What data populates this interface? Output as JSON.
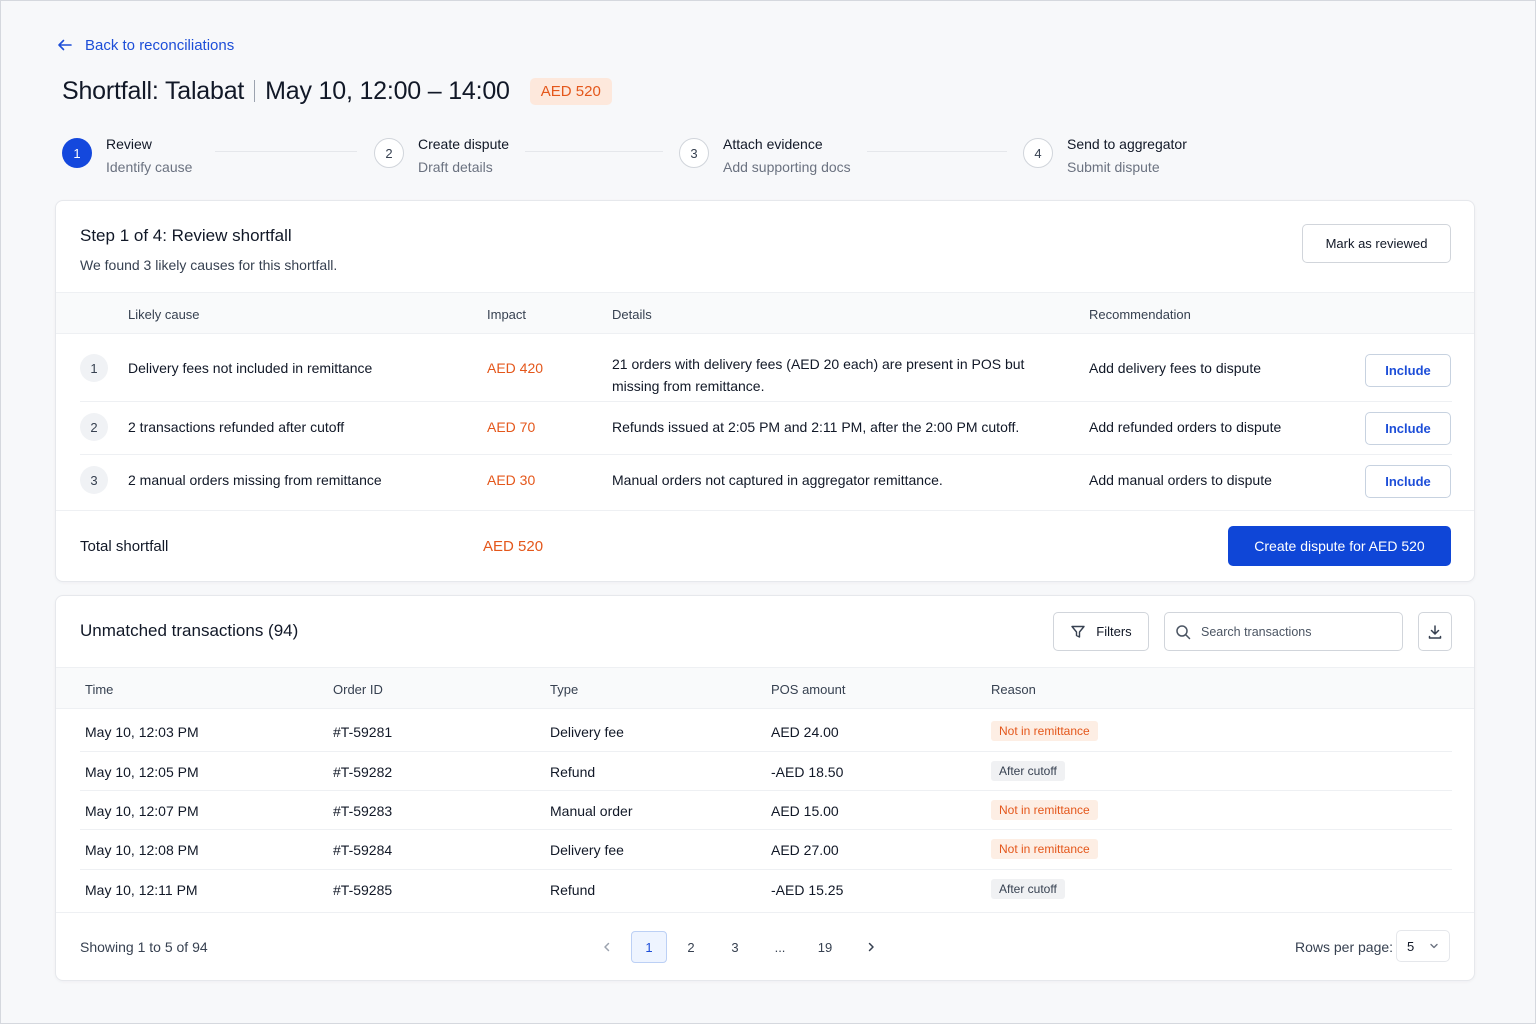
{
  "back_link": {
    "label": "Back to reconciliations"
  },
  "header": {
    "title_left": "Shortfall: Talabat",
    "title_right": "May 10, 12:00 – 14:00",
    "amount_badge": "AED 520"
  },
  "steps": [
    {
      "num": "1",
      "title": "Review",
      "subtitle": "Identify cause"
    },
    {
      "num": "2",
      "title": "Create dispute",
      "subtitle": "Draft details"
    },
    {
      "num": "3",
      "title": "Attach evidence",
      "subtitle": "Add supporting docs"
    },
    {
      "num": "4",
      "title": "Send to aggregator",
      "subtitle": "Submit dispute"
    }
  ],
  "review": {
    "title": "Step 1 of 4: Review shortfall",
    "subtitle": "We found 3 likely causes for this shortfall.",
    "mark_reviewed": "Mark as reviewed",
    "columns": {
      "cause": "Likely cause",
      "impact": "Impact",
      "details": "Details",
      "recommendation": "Recommendation"
    },
    "rows": [
      {
        "num": "1",
        "cause": "Delivery fees not included in remittance",
        "impact": "AED 420",
        "details_1": "21 orders with delivery fees (AED 20 each) are present in POS but",
        "details_2": "missing from remittance.",
        "recommendation": "Add delivery fees to dispute",
        "action": "Include"
      },
      {
        "num": "2",
        "cause": "2 transactions refunded after cutoff",
        "impact": "AED 70",
        "details_1": "Refunds issued at 2:05 PM and 2:11 PM, after the 2:00 PM cutoff.",
        "details_2": "",
        "recommendation": "Add refunded orders to dispute",
        "action": "Include"
      },
      {
        "num": "3",
        "cause": "2 manual orders missing from remittance",
        "impact": "AED 30",
        "details_1": "Manual orders not captured in aggregator remittance.",
        "details_2": "",
        "recommendation": "Add manual orders to dispute",
        "action": "Include"
      }
    ],
    "total_label": "Total shortfall",
    "total_value": "AED 520",
    "create_button": "Create dispute for AED 520"
  },
  "unmatched": {
    "title": "Unmatched transactions (94)",
    "filters_label": "Filters",
    "search_placeholder": "Search transactions",
    "columns": {
      "time": "Time",
      "order_id": "Order ID",
      "type": "Type",
      "pos_amount": "POS amount",
      "reason": "Reason"
    },
    "rows": [
      {
        "time": "May 10, 12:03 PM",
        "order_id": "#T-59281",
        "type": "Delivery fee",
        "amount": "AED 24.00",
        "reason": "Not in remittance",
        "reason_kind": "orange"
      },
      {
        "time": "May 10, 12:05 PM",
        "order_id": "#T-59282",
        "type": "Refund",
        "amount": "-AED 18.50",
        "reason": "After cutoff",
        "reason_kind": "gray"
      },
      {
        "time": "May 10, 12:07 PM",
        "order_id": "#T-59283",
        "type": "Manual order",
        "amount": "AED 15.00",
        "reason": "Not in remittance",
        "reason_kind": "orange"
      },
      {
        "time": "May 10, 12:08 PM",
        "order_id": "#T-59284",
        "type": "Delivery fee",
        "amount": "AED 27.00",
        "reason": "Not in remittance",
        "reason_kind": "orange"
      },
      {
        "time": "May 10, 12:11 PM",
        "order_id": "#T-59285",
        "type": "Refund",
        "amount": "-AED 15.25",
        "reason": "After cutoff",
        "reason_kind": "gray"
      }
    ],
    "showing": "Showing 1 to 5 of 94",
    "pages": [
      "1",
      "2",
      "3",
      "...",
      "19"
    ],
    "rows_per_page_label": "Rows per page:",
    "rows_per_page_value": "5"
  },
  "colors": {
    "primary": "#0f46d7",
    "accent_orange": "#e4571b"
  }
}
